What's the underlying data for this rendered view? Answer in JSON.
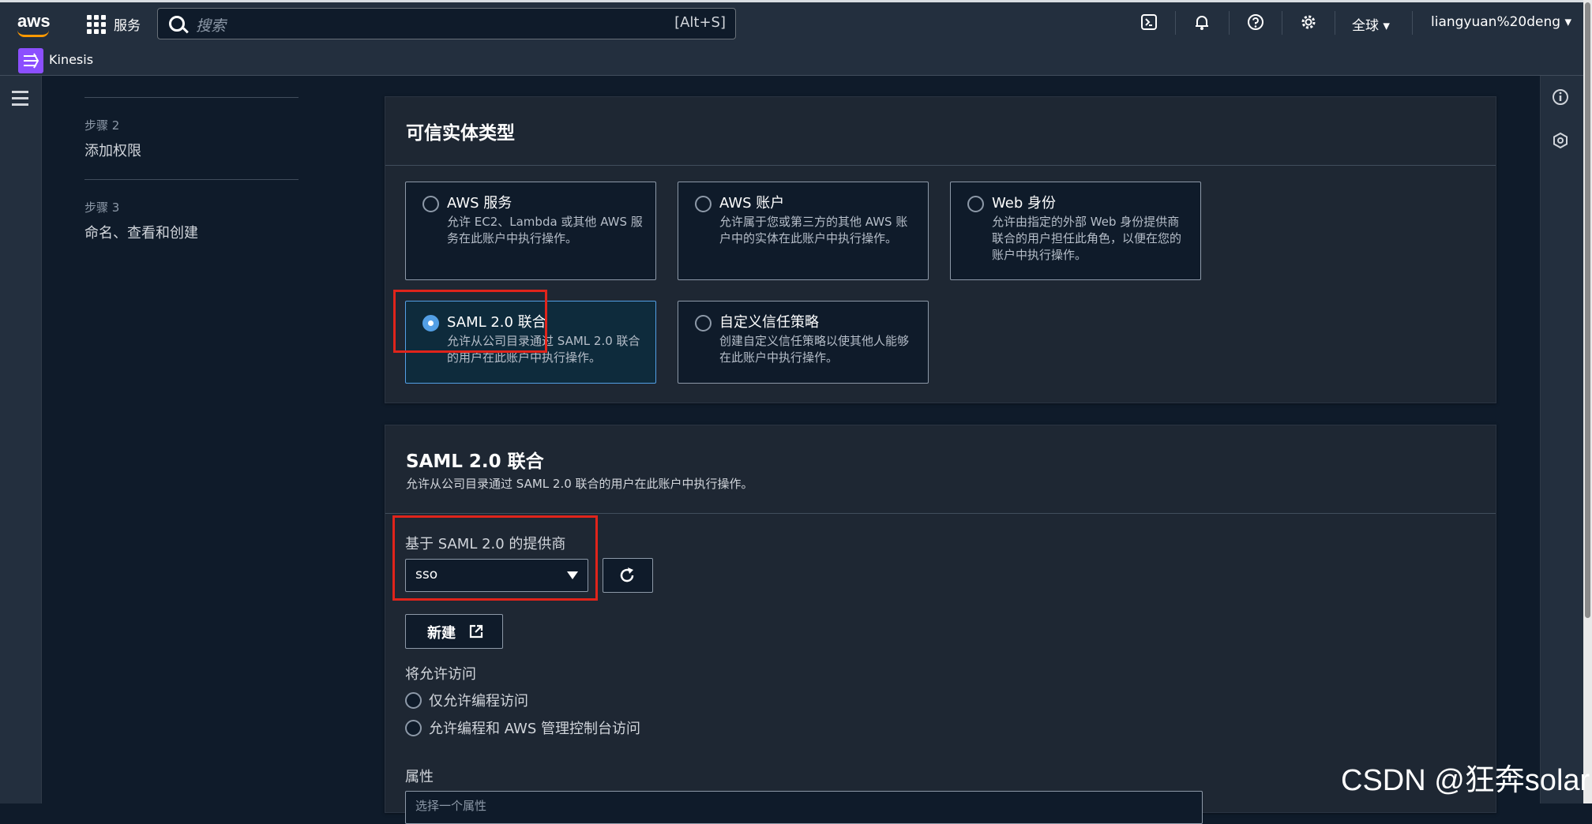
{
  "topbar": {
    "logo_text": "aws",
    "services_label": "服务",
    "search_placeholder": "搜索",
    "search_shortcut": "[Alt+S]",
    "icons": [
      "cloudshell-icon",
      "bell-icon",
      "help-icon",
      "gear-icon"
    ],
    "region_label": "全球",
    "user_label": "liangyuan%20deng"
  },
  "service_bar": {
    "service_name": "Kinesis"
  },
  "steps": [
    {
      "number": "步骤 2",
      "name": "添加权限"
    },
    {
      "number": "步骤 3",
      "name": "命名、查看和创建"
    }
  ],
  "trusted_entity": {
    "title": "可信实体类型",
    "options": [
      {
        "title": "AWS 服务",
        "desc": "允许 EC2、Lambda 或其他 AWS 服务在此账户中执行操作。",
        "selected": false
      },
      {
        "title": "AWS 账户",
        "desc": "允许属于您或第三方的其他 AWS 账户中的实体在此账户中执行操作。",
        "selected": false
      },
      {
        "title": "Web 身份",
        "desc": "允许由指定的外部 Web 身份提供商联合的用户担任此角色，以便在您的账户中执行操作。",
        "selected": false
      },
      {
        "title": "SAML 2.0 联合",
        "desc": "允许从公司目录通过 SAML 2.0 联合的用户在此账户中执行操作。",
        "selected": true
      },
      {
        "title": "自定义信任策略",
        "desc": "创建自定义信任策略以使其他人能够在此账户中执行操作。",
        "selected": false
      }
    ]
  },
  "saml": {
    "title": "SAML 2.0 联合",
    "subtitle": "允许从公司目录通过 SAML 2.0 联合的用户在此账户中执行操作。",
    "provider_label": "基于 SAML 2.0 的提供商",
    "provider_value": "sso",
    "new_button": "新建",
    "access_label": "将允许访问",
    "access_options": [
      "仅允许编程访问",
      "允许编程和 AWS 管理控制台访问"
    ],
    "attributes_label": "属性",
    "attributes_partial": "选择一个属性"
  },
  "watermark": "CSDN @狂奔solar",
  "colors": {
    "accent": "#539fe5",
    "highlight_box": "#e0241b",
    "brand": "#ff9900"
  }
}
